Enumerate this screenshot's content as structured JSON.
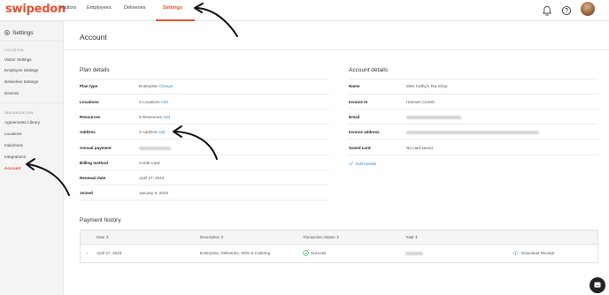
{
  "brand": {
    "name": "swipedon",
    "accent": "#e8502f",
    "link": "#2d8fd5"
  },
  "nav": {
    "items": [
      {
        "label": "Visitors"
      },
      {
        "label": "Employees"
      },
      {
        "label": "Deliveries"
      },
      {
        "label": "Settings",
        "active": true
      }
    ],
    "icons": [
      "bell-icon",
      "help-icon",
      "avatar"
    ]
  },
  "sidebar": {
    "title": "Settings",
    "sections": [
      {
        "label": "LOCATION",
        "items": [
          "Visitor Settings",
          "Employee Settings",
          "Deliveries Settings",
          "Devices"
        ]
      },
      {
        "label": "ORGANIZATION",
        "items": [
          "Agreements Library",
          "Locations",
          "Inductions",
          "Integrations",
          "Account"
        ]
      }
    ],
    "active": "Account"
  },
  "page": {
    "title": "Account"
  },
  "plan": {
    "heading": "Plan details",
    "rows": [
      {
        "label": "Plan type",
        "value": "Enterprise",
        "action": "Change"
      },
      {
        "label": "Locations",
        "value": "3 Locations",
        "action": "Add"
      },
      {
        "label": "Resources",
        "value": "0 Resources",
        "action": "Add"
      },
      {
        "label": "AddOns",
        "value": "3 AddOns",
        "action": "Add"
      },
      {
        "label": "Annual payment",
        "value": "",
        "action": ""
      },
      {
        "label": "Billing method",
        "value": "Credit Card",
        "action": ""
      },
      {
        "label": "Renewal date",
        "value": "April 27, 2024",
        "action": ""
      },
      {
        "label": "Joined",
        "value": "January 6, 2023",
        "action": ""
      }
    ]
  },
  "account": {
    "heading": "Account details",
    "rows": [
      {
        "label": "Name",
        "value": "Miss Cathy's Tea Shop"
      },
      {
        "label": "Invoice to",
        "value": "Hannah Crossit"
      },
      {
        "label": "Email",
        "value": ""
      },
      {
        "label": "Invoice address",
        "value": ""
      },
      {
        "label": "Saved card",
        "value": "No card saved"
      }
    ],
    "edit_label": "Edit Details"
  },
  "payment_history": {
    "heading": "Payment history",
    "columns": [
      "Date",
      "Description",
      "Transaction Status",
      "Total"
    ],
    "rows": [
      {
        "date": "April 27, 2023",
        "description": "Enterprise, Deliveries, SMS & Catering",
        "status": "Success",
        "total": "",
        "action": "Download Receipt"
      }
    ]
  }
}
